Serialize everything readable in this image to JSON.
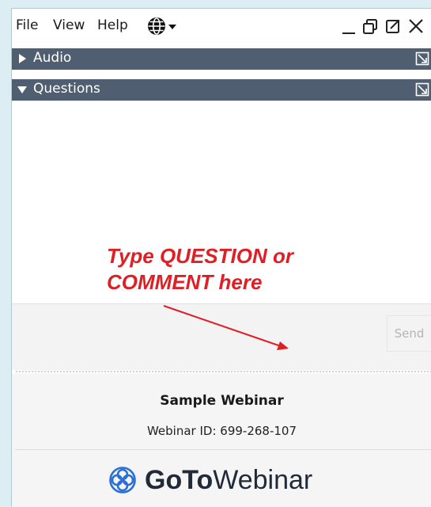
{
  "menu": {
    "file": "File",
    "view": "View",
    "help": "Help"
  },
  "sections": {
    "audio": "Audio",
    "questions": "Questions"
  },
  "annotation": "Type QUESTION or\nCOMMENT here",
  "input": {
    "value": "",
    "send_label": "Send"
  },
  "footer": {
    "webinar_title": "Sample Webinar",
    "webinar_id": "Webinar ID: 699-268-107",
    "brand_bold": "GoTo",
    "brand_light": "Webinar"
  },
  "colors": {
    "header_bg": "#4f5e70",
    "annotation": "#e01e25",
    "page_bg": "#dceef4",
    "brand_icon": "#2a6fd6"
  },
  "icons": {
    "globe": "globe-icon",
    "minimize": "minimize-icon",
    "restore": "restore-icon",
    "popout": "popout-icon",
    "close": "close-icon"
  }
}
